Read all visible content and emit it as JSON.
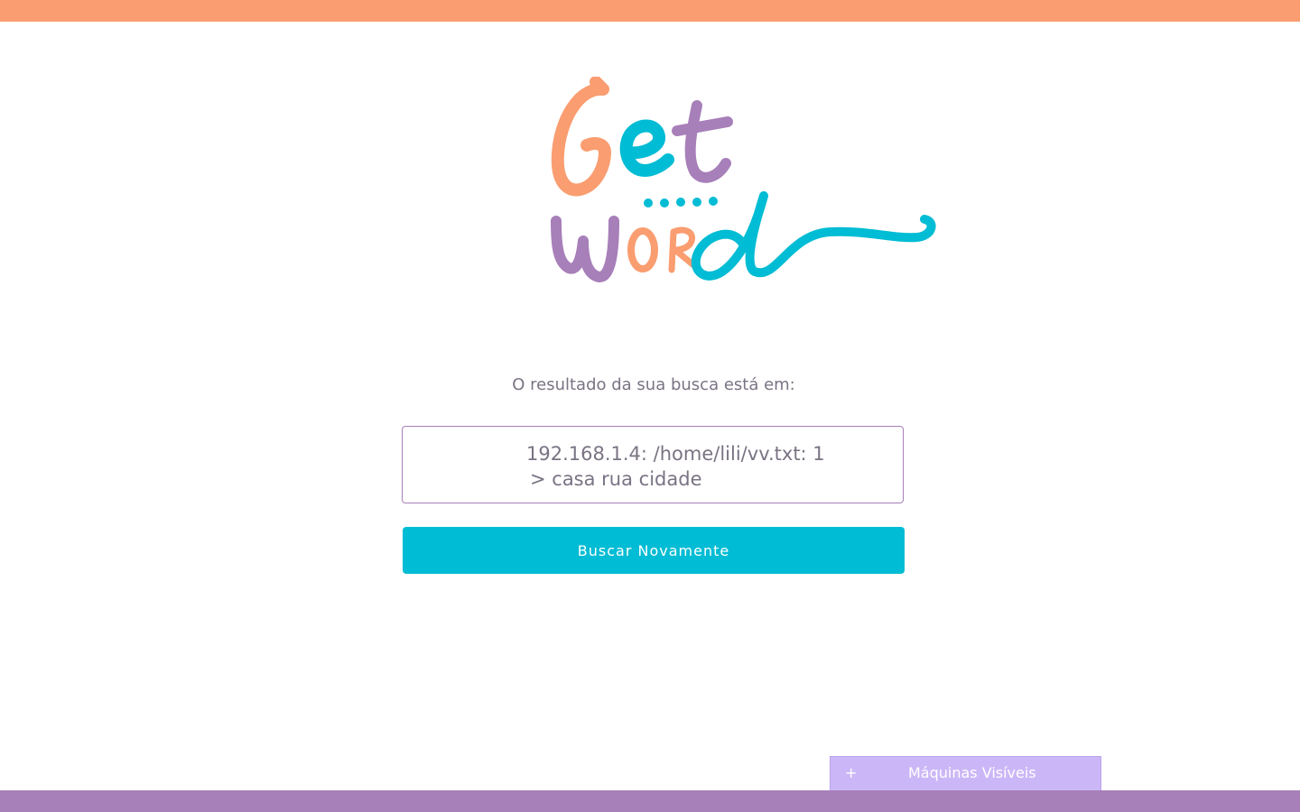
{
  "header": {
    "color": "#fa9d70"
  },
  "logo": {
    "word_1": "Get",
    "word_2": "word",
    "colors": {
      "orange": "#fa9d70",
      "cyan": "#00bcd4",
      "purple": "#a77fb9"
    }
  },
  "result": {
    "label": "O resultado da sua busca está em:",
    "line_1": "192.168.1.4: /home/lili/vv.txt: 1",
    "line_2": "> casa rua cidade"
  },
  "actions": {
    "search_again_label": "Buscar Novamente",
    "button_color": "#00bcd4"
  },
  "machines_panel": {
    "expand_icon": "plus-icon",
    "expand_glyph": "+",
    "label": "Máquinas Visíveis",
    "color": "#cbb7f7"
  },
  "footer": {
    "color": "#a77fb9"
  }
}
